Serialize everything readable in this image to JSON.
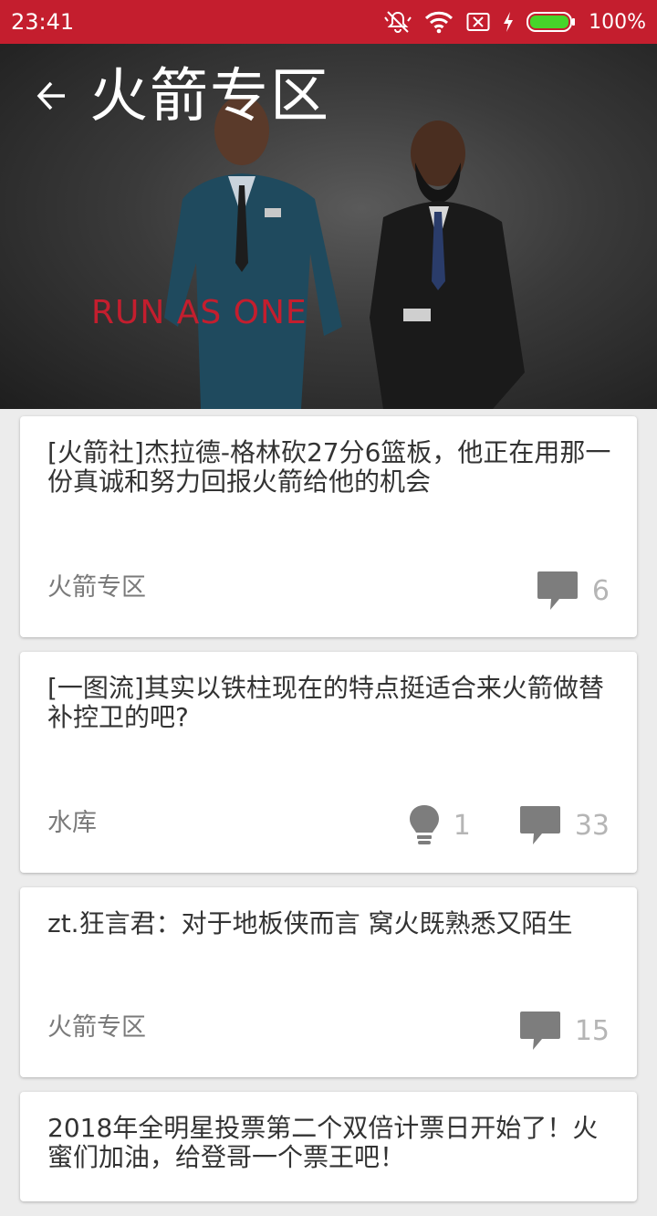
{
  "status_bar": {
    "time": "23:41",
    "battery": "100%",
    "icons": [
      "mute-icon",
      "wifi-icon",
      "no-sim-icon",
      "charging-icon",
      "battery-icon"
    ]
  },
  "header": {
    "title": "火箭专区",
    "slogan": "RUN AS ONE",
    "back_icon": "arrow-left-icon"
  },
  "posts": [
    {
      "title": "[火箭社]杰拉德-格林砍27分6篮板，他正在用那一份真诚和努力回报火箭给他的机会",
      "source": "火箭专区",
      "comments": "6"
    },
    {
      "title": "[一图流]其实以铁柱现在的特点挺适合来火箭做替补控卫的吧?",
      "source": "水库",
      "lights": "1",
      "comments": "33"
    },
    {
      "title": "zt.狂言君：对于地板侠而言 窝火既熟悉又陌生",
      "source": "火箭专区",
      "comments": "15"
    },
    {
      "title": "2018年全明星投票第二个双倍计票日开始了！火蜜们加油，给登哥一个票王吧！"
    }
  ],
  "colors": {
    "accent": "#c41e2e",
    "icon_gray": "#7d7d7d",
    "count_gray": "#b5b5b5"
  }
}
